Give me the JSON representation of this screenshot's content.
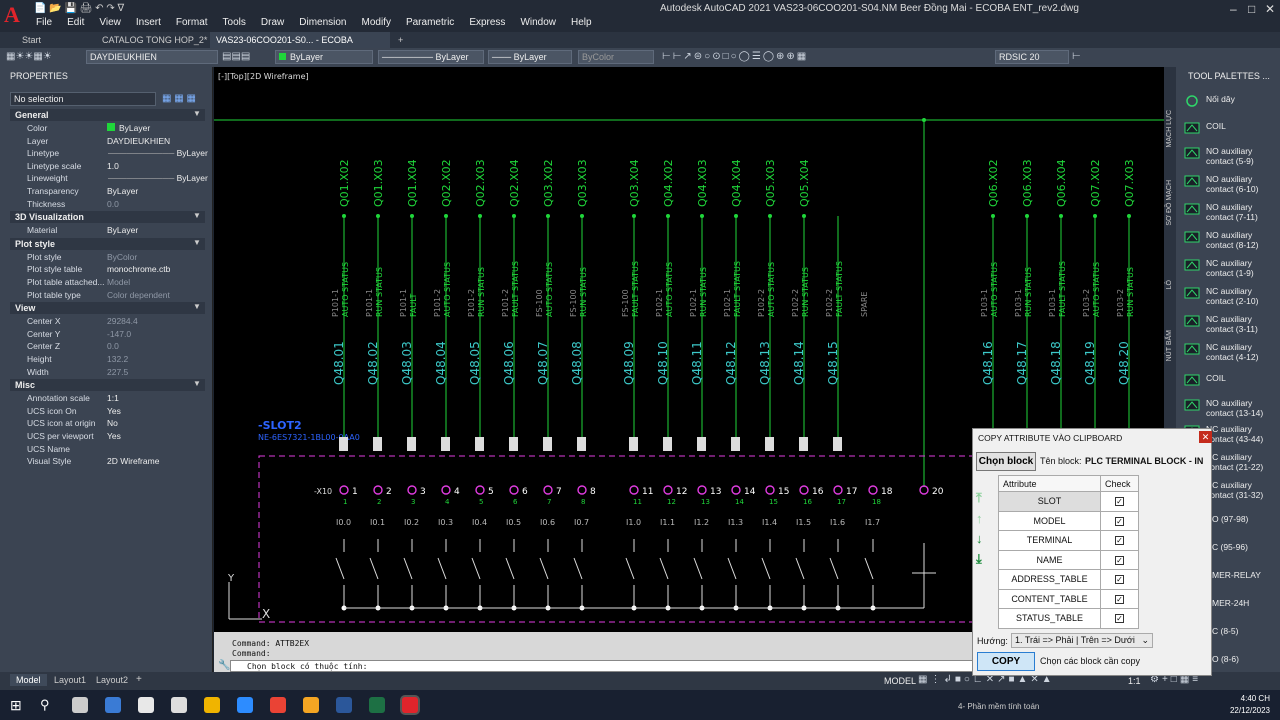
{
  "app": {
    "logo": "A",
    "title": "Autodesk AutoCAD 2021    VAS23-06COO201-S04.NM Beer Đồng Mai - ECOBA ENT_rev2.dwg",
    "menu": [
      "File",
      "Edit",
      "View",
      "Insert",
      "Format",
      "Tools",
      "Draw",
      "Dimension",
      "Modify",
      "Parametric",
      "Express",
      "Window",
      "Help"
    ]
  },
  "tabs": [
    "Start",
    "CATALOG TONG HOP_2*",
    "VAS23-06COO201-S0... - ECOBA ENT_rev2*"
  ],
  "toolbar": {
    "layer": "DAYDIEUKHIEN",
    "color": "ByLayer",
    "linetype": "ByLayer",
    "lineweight": "ByLayer",
    "plotstyle": "ByColor",
    "style": "RDSIC 20"
  },
  "properties": {
    "title": "PROPERTIES",
    "selection": "No selection",
    "sections": [
      {
        "name": "General",
        "rows": [
          [
            "Color",
            "ByLayer"
          ],
          [
            "Layer",
            "DAYDIEUKHIEN"
          ],
          [
            "Linetype",
            "ByLayer"
          ],
          [
            "Linetype scale",
            "1.0"
          ],
          [
            "Lineweight",
            "ByLayer"
          ],
          [
            "Transparency",
            "ByLayer"
          ],
          [
            "Thickness",
            "0.0"
          ]
        ]
      },
      {
        "name": "3D Visualization",
        "rows": [
          [
            "Material",
            "ByLayer"
          ]
        ]
      },
      {
        "name": "Plot style",
        "rows": [
          [
            "Plot style",
            "ByColor"
          ],
          [
            "Plot style table",
            "monochrome.ctb"
          ],
          [
            "Plot table attached...",
            "Model"
          ],
          [
            "Plot table type",
            "Color dependent"
          ]
        ]
      },
      {
        "name": "View",
        "rows": [
          [
            "Center X",
            "29284.4"
          ],
          [
            "Center Y",
            "-147.0"
          ],
          [
            "Center Z",
            "0.0"
          ],
          [
            "Height",
            "132.2"
          ],
          [
            "Width",
            "227.5"
          ]
        ]
      },
      {
        "name": "Misc",
        "rows": [
          [
            "Annotation scale",
            "1:1"
          ],
          [
            "UCS icon On",
            "Yes"
          ],
          [
            "UCS icon at origin",
            "No"
          ],
          [
            "UCS per viewport",
            "Yes"
          ],
          [
            "UCS Name",
            ""
          ],
          [
            "Visual Style",
            "2D Wireframe"
          ]
        ]
      }
    ]
  },
  "viewport": {
    "label": "[-][Top][2D Wireframe]",
    "slot": "-SLOT2",
    "slot_sub": "NE-6ES7321-1BL00-0AA0",
    "terminal_prefix": "-X10",
    "top_labels": [
      "Q01.X02",
      "Q01.X03",
      "Q01.X04",
      "Q02.X02",
      "Q02.X03",
      "Q02.X04",
      "Q03.X02",
      "Q03.X03",
      "Q03.X04",
      "Q04.X02",
      "Q04.X03",
      "Q04.X04",
      "Q05.X03",
      "Q05.X04",
      "Q06.X02",
      "Q06.X03",
      "Q06.X04",
      "Q07.X02",
      "Q07.X03"
    ],
    "mid1": [
      "P101-1",
      "P101-1",
      "P101-1",
      "P101-2",
      "P101-2",
      "P101-2",
      "FS-100",
      "FS-100",
      "FS-100",
      "P102-1",
      "P102-1",
      "P102-1",
      "P102-2",
      "P102-2",
      "P102-2",
      "SPARE",
      "P103-1",
      "P103-1",
      "P103-1",
      "P103-2",
      "P103-2",
      "P103-2"
    ],
    "mid2": [
      "AUTO STATUS",
      "RUN STATUS",
      "FAULT",
      "AUTO STATUS",
      "RUN STATUS",
      "FAULT STATUS",
      "AUTO STATUS",
      "RUN STATUS",
      "FAULT STATUS",
      "AUTO STATUS",
      "RUN STATUS",
      "FAULT STATUS",
      "AUTO STATUS",
      "RUN STATUS",
      "FAULT STATUS",
      "",
      "AUTO STATUS",
      "RUN STATUS",
      "FAULT STATUS",
      "AUTO STATUS",
      "RUN STATUS",
      "FAULT STATUS"
    ],
    "q48": [
      "Q48.01",
      "Q48.02",
      "Q48.03",
      "Q48.04",
      "Q48.05",
      "Q48.06",
      "Q48.07",
      "Q48.08",
      "Q48.09",
      "Q48.10",
      "Q48.11",
      "Q48.12",
      "Q48.13",
      "Q48.14",
      "Q48.15",
      "Q48.16",
      "Q48.17",
      "Q48.18",
      "Q48.19",
      "Q48.20",
      "Q48.21"
    ],
    "terminals": [
      "1",
      "2",
      "3",
      "4",
      "5",
      "6",
      "7",
      "8",
      "11",
      "12",
      "13",
      "14",
      "15",
      "16",
      "17",
      "18",
      "20"
    ],
    "addresses": [
      "I0.0",
      "I0.1",
      "I0.2",
      "I0.3",
      "I0.4",
      "I0.5",
      "I0.6",
      "I0.7",
      "I1.0",
      "I1.1",
      "I1.2",
      "I1.3",
      "I1.4",
      "I1.5",
      "I1.6",
      "I1.7"
    ]
  },
  "command": {
    "line1": "Command: ATTB2EX",
    "line2": "Command:",
    "prompt": "Chọn block có thuộc tính:"
  },
  "layout_tabs": [
    "Model",
    "Layout1",
    "Layout2"
  ],
  "status": {
    "model": "MODEL",
    "scale": "1:1"
  },
  "tool_palettes": {
    "title": "TOOL PALETTES ...",
    "side_tabs": [
      "MẠCH LỰC",
      "SƠ ĐỒ MẠCH",
      "LÔ",
      "NÚT BẤM"
    ],
    "items": [
      "Nối dây",
      "COIL",
      "NO auxiliary contact (5-9)",
      "NO auxiliary contact (6-10)",
      "NO auxiliary contact (7-11)",
      "NO auxiliary contact (8-12)",
      "NC auxiliary contact (1-9)",
      "NC auxiliary contact (2-10)",
      "NC auxiliary contact (3-11)",
      "NC auxiliary contact (4-12)",
      "COIL",
      "NO auxiliary contact (13-14)",
      "NC auxiliary contact (43-44)",
      "NC auxiliary contact (21-22)",
      "NC auxiliary contact (31-32)",
      "O (97-98)",
      "C (95-96)",
      "MER-RELAY",
      "MER-24H",
      "C (8-5)",
      "O (8-6)"
    ]
  },
  "dialog": {
    "title": "COPY ATTRIBUTE VÀO CLIPBOARD",
    "choose_btn": "Chọn block",
    "block_label": "Tên block:",
    "block_name": "PLC TERMINAL BLOCK - IN",
    "col_attr": "Attribute",
    "col_check": "Check",
    "attributes": [
      "SLOT",
      "MODEL",
      "TERMINAL",
      "NAME",
      "ADDRESS_TABLE",
      "CONTENT_TABLE",
      "STATUS_TABLE"
    ],
    "direction_label": "Hướng:",
    "direction_value": "1. Trái => Phải | Trên => Dưới",
    "copy_btn": "COPY",
    "hint": "Chọn các block cần copy"
  },
  "taskbar": {
    "time": "4:40 CH",
    "date": "22/12/2023",
    "notice": "4- Phần mềm tính toán"
  },
  "colors": {
    "green": "#1fd63a",
    "cyan": "#3cc8c8",
    "magenta": "#e03ce0",
    "blue": "#2d64ff"
  }
}
